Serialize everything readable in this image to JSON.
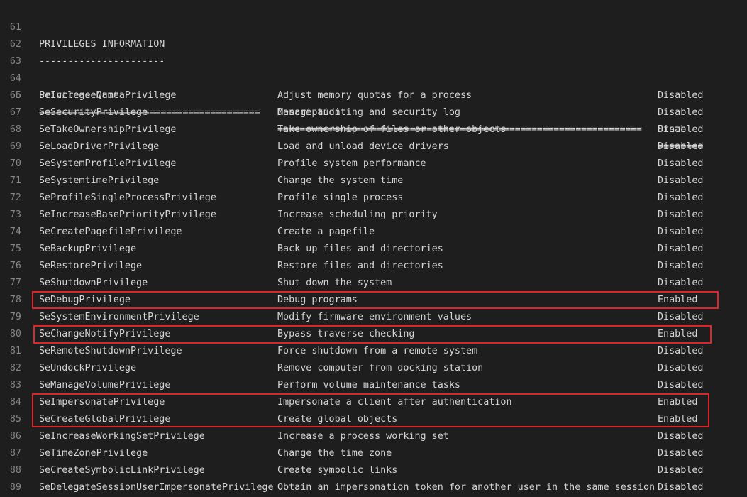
{
  "header": {
    "title": {
      "line_number": "61",
      "text": "PRIVILEGES INFORMATION"
    },
    "underline": {
      "line_number": "62",
      "text": "----------------------"
    },
    "blank": {
      "line_number": "63"
    },
    "columns": {
      "line_number": "64",
      "name": "Privilege Name",
      "description": "Description",
      "state": "State"
    },
    "separator": {
      "line_number": "65",
      "name": "========================================",
      "description": "==================================================================",
      "state": "========"
    }
  },
  "rows": [
    {
      "line_number": "66",
      "name": "SeIncreaseQuotaPrivilege",
      "description": "Adjust memory quotas for a process",
      "state": "Disabled",
      "highlighted": false
    },
    {
      "line_number": "67",
      "name": "SeSecurityPrivilege",
      "description": "Manage auditing and security log",
      "state": "Disabled",
      "highlighted": false
    },
    {
      "line_number": "68",
      "name": "SeTakeOwnershipPrivilege",
      "description": "Take ownership of files or other objects",
      "state": "Disabled",
      "highlighted": false
    },
    {
      "line_number": "69",
      "name": "SeLoadDriverPrivilege",
      "description": "Load and unload device drivers",
      "state": "Disabled",
      "highlighted": false
    },
    {
      "line_number": "70",
      "name": "SeSystemProfilePrivilege",
      "description": "Profile system performance",
      "state": "Disabled",
      "highlighted": false
    },
    {
      "line_number": "71",
      "name": "SeSystemtimePrivilege",
      "description": "Change the system time",
      "state": "Disabled",
      "highlighted": false
    },
    {
      "line_number": "72",
      "name": "SeProfileSingleProcessPrivilege",
      "description": "Profile single process",
      "state": "Disabled",
      "highlighted": false
    },
    {
      "line_number": "73",
      "name": "SeIncreaseBasePriorityPrivilege",
      "description": "Increase scheduling priority",
      "state": "Disabled",
      "highlighted": false
    },
    {
      "line_number": "74",
      "name": "SeCreatePagefilePrivilege",
      "description": "Create a pagefile",
      "state": "Disabled",
      "highlighted": false
    },
    {
      "line_number": "75",
      "name": "SeBackupPrivilege",
      "description": "Back up files and directories",
      "state": "Disabled",
      "highlighted": false
    },
    {
      "line_number": "76",
      "name": "SeRestorePrivilege",
      "description": "Restore files and directories",
      "state": "Disabled",
      "highlighted": false
    },
    {
      "line_number": "77",
      "name": "SeShutdownPrivilege",
      "description": "Shut down the system",
      "state": "Disabled",
      "highlighted": false
    },
    {
      "line_number": "78",
      "name": "SeDebugPrivilege",
      "description": "Debug programs",
      "state": "Enabled",
      "highlighted": true
    },
    {
      "line_number": "79",
      "name": "SeSystemEnvironmentPrivilege",
      "description": "Modify firmware environment values",
      "state": "Disabled",
      "highlighted": false
    },
    {
      "line_number": "80",
      "name": "SeChangeNotifyPrivilege",
      "description": "Bypass traverse checking",
      "state": "Enabled",
      "highlighted": true
    },
    {
      "line_number": "81",
      "name": "SeRemoteShutdownPrivilege",
      "description": "Force shutdown from a remote system",
      "state": "Disabled",
      "highlighted": false
    },
    {
      "line_number": "82",
      "name": "SeUndockPrivilege",
      "description": "Remove computer from docking station",
      "state": "Disabled",
      "highlighted": false
    },
    {
      "line_number": "83",
      "name": "SeManageVolumePrivilege",
      "description": "Perform volume maintenance tasks",
      "state": "Disabled",
      "highlighted": false
    },
    {
      "line_number": "84",
      "name": "SeImpersonatePrivilege",
      "description": "Impersonate a client after authentication",
      "state": "Enabled",
      "highlighted": true
    },
    {
      "line_number": "85",
      "name": "SeCreateGlobalPrivilege",
      "description": "Create global objects",
      "state": "Enabled",
      "highlighted": true
    },
    {
      "line_number": "86",
      "name": "SeIncreaseWorkingSetPrivilege",
      "description": "Increase a process working set",
      "state": "Disabled",
      "highlighted": false
    },
    {
      "line_number": "87",
      "name": "SeTimeZonePrivilege",
      "description": "Change the time zone",
      "state": "Disabled",
      "highlighted": false
    },
    {
      "line_number": "88",
      "name": "SeCreateSymbolicLinkPrivilege",
      "description": "Create symbolic links",
      "state": "Disabled",
      "highlighted": false
    },
    {
      "line_number": "89",
      "name": "SeDelegateSessionUserImpersonatePrivilege",
      "description": "Obtain an impersonation token for another user in the same session",
      "state": "Disabled",
      "highlighted": false
    }
  ],
  "colors": {
    "background": "#1e1e1e",
    "text": "#d4d4d4",
    "line_number": "#858585",
    "highlight_box": "#e0242b"
  }
}
